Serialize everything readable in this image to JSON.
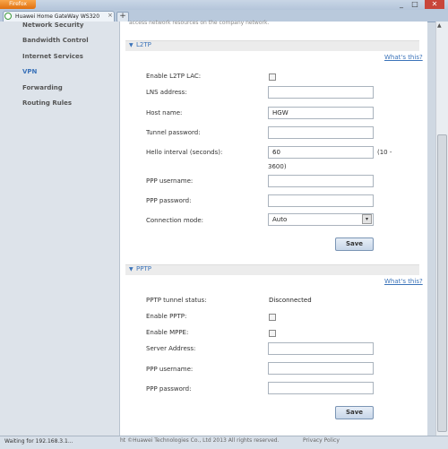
{
  "browser": {
    "menu_button_label": "Firefox",
    "tab_title": "Huawei Home GateWay WS320",
    "tab_close": "×",
    "new_tab": "+",
    "min": "_",
    "max": "□",
    "close": "✕"
  },
  "nav": {
    "items": [
      {
        "label": "Network Security"
      },
      {
        "label": "Bandwidth Control"
      },
      {
        "label": "Internet Services"
      },
      {
        "label": "VPN"
      },
      {
        "label": "Forwarding"
      },
      {
        "label": "Routing Rules"
      }
    ]
  },
  "page": {
    "top_fragment": "access network resources on the company network."
  },
  "l2tp": {
    "title": "L2TP",
    "whats_this": "What's this?",
    "enable_lac_label": "Enable L2TP LAC:",
    "lns_address_label": "LNS address:",
    "lns_address_value": "",
    "host_name_label": "Host name:",
    "host_name_value": "HGW",
    "tunnel_password_label": "Tunnel password:",
    "tunnel_password_value": "",
    "hello_interval_label": "Hello interval (seconds):",
    "hello_interval_value": "60",
    "hello_range_part1": "(10 -",
    "hello_range_part2": "3600)",
    "ppp_username_label": "PPP username:",
    "ppp_username_value": "",
    "ppp_password_label": "PPP password:",
    "ppp_password_value": "",
    "connection_mode_label": "Connection mode:",
    "connection_mode_value": "Auto",
    "save_label": "Save"
  },
  "pptp": {
    "title": "PPTP",
    "whats_this": "What's this?",
    "tunnel_status_label": "PPTP tunnel status:",
    "tunnel_status_value": "Disconnected",
    "enable_pptp_label": "Enable PPTP:",
    "enable_mppe_label": "Enable MPPE:",
    "server_address_label": "Server Address:",
    "server_address_value": "",
    "ppp_username_label": "PPP username:",
    "ppp_username_value": "",
    "ppp_password_label": "PPP password:",
    "ppp_password_value": "",
    "save_label": "Save"
  },
  "status": {
    "text": "Waiting for 192.168.3.1...",
    "copyright": "ht ©Huawei Technologies Co., Ltd 2013 All rights reserved.",
    "privacy": "Privacy Policy"
  },
  "colors": {
    "accent": "#3b73b9",
    "nav_bg": "#dde3ea",
    "firefox_orange": "#e0700f"
  }
}
